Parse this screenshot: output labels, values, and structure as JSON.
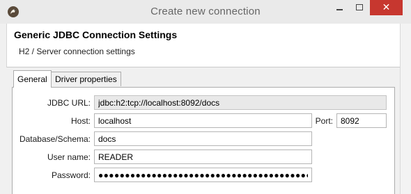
{
  "window": {
    "title": "Create new connection",
    "close_glyph": "✕"
  },
  "header": {
    "title": "Generic JDBC Connection Settings",
    "subtitle": "H2 / Server connection settings"
  },
  "tabs": [
    {
      "label": "General",
      "active": true
    },
    {
      "label": "Driver properties",
      "active": false
    }
  ],
  "form": {
    "jdbc_url": {
      "label": "JDBC URL:",
      "value": "jdbc:h2:tcp://localhost:8092/docs"
    },
    "host": {
      "label": "Host:",
      "value": "localhost"
    },
    "port": {
      "label": "Port:",
      "value": "8092"
    },
    "database": {
      "label": "Database/Schema:",
      "value": "docs"
    },
    "user": {
      "label": "User name:",
      "value": "READER"
    },
    "password": {
      "label": "Password:",
      "value": "●●●●●●●●●●●●●●●●●●●●●●●●●●●●●●●●●●●●●●●●●●"
    }
  },
  "colors": {
    "close_button": "#c7372f",
    "header_bg": "#ffffff",
    "window_bg": "#f0f0f0"
  },
  "icons": {
    "app": "dbeaver-beaver-icon"
  }
}
